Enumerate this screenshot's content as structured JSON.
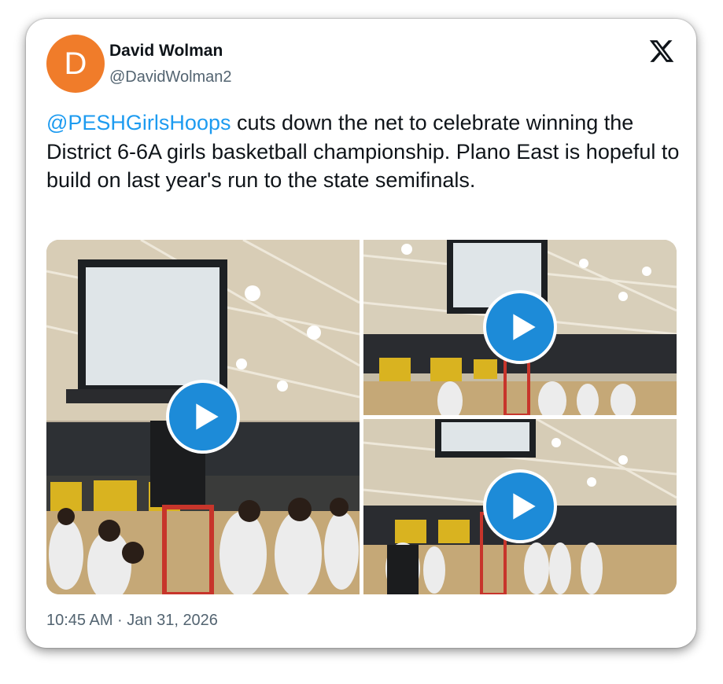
{
  "author": {
    "avatar_letter": "D",
    "name": "David Wolman",
    "handle": "@DavidWolman2",
    "avatar_color": "#f07c2a"
  },
  "platform_icon": "x-logo-icon",
  "tweet": {
    "mention": "@PESHGirlsHoops",
    "body": " cuts down the net to celebrate winning the District 6-6A girls basketball championship. Plano East is hopeful to build on last year's run to the state semifinals."
  },
  "media": [
    {
      "kind": "video",
      "icon": "play-icon"
    },
    {
      "kind": "video",
      "icon": "play-icon"
    },
    {
      "kind": "video",
      "icon": "play-icon"
    }
  ],
  "timestamp": "10:45 AM · Jan 31, 2026",
  "colors": {
    "link": "#1d9bf0",
    "play_button": "#1d8bd8",
    "muted": "#536471"
  }
}
